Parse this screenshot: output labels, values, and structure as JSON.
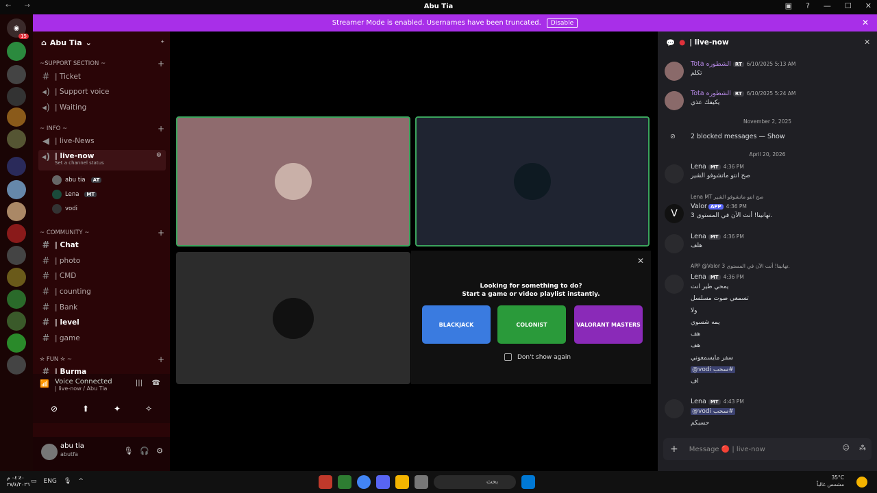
{
  "window": {
    "title": "Abu Tia",
    "nav": "← →"
  },
  "banner": {
    "text": "Streamer Mode is enabled. Usernames have been truncated.",
    "button": "Disable"
  },
  "guilds": {
    "badge": "15"
  },
  "server": {
    "name": "Abu Tia"
  },
  "categories": [
    {
      "label": "~SUPPORT SECTION ~"
    },
    {
      "label": "~ INFO ~"
    },
    {
      "label": "~ COMMUNITY ~"
    },
    {
      "label": "✮ FUN ✮ ~"
    }
  ],
  "channels": [
    {
      "name": "| Ticket"
    },
    {
      "name": "| Support voice"
    },
    {
      "name": "| Waiting"
    },
    {
      "name": "| live-News"
    },
    {
      "name": "| live-now",
      "sub": "Set a channel status"
    },
    {
      "name": "| Chat"
    },
    {
      "name": "| photo"
    },
    {
      "name": "| CMD"
    },
    {
      "name": "| counting"
    },
    {
      "name": "| Bank"
    },
    {
      "name": "| level"
    },
    {
      "name": "| game"
    },
    {
      "name": "| Burma"
    }
  ],
  "voice_users": [
    {
      "name": "abu tia",
      "tag": "AT"
    },
    {
      "name": "Lena",
      "tag": "MT"
    },
    {
      "name": "vodi",
      "tag": ""
    }
  ],
  "voice_panel": {
    "status": "Voice Connected",
    "location": "| live-now / Abu Tia"
  },
  "me": {
    "name": "abu tia",
    "status": "abutfa"
  },
  "activity": {
    "line1": "Looking for something to do?",
    "line2": "Start a game or video playlist instantly.",
    "cards": [
      "BLACKJACK",
      "COLONIST",
      "VALORANT MASTERS"
    ],
    "checkbox": "Don't show again"
  },
  "chat": {
    "channel": "| live-now",
    "messages": [
      {
        "author": "Tota",
        "author_suffix": "الشطوره",
        "tag": "RT",
        "time": "6/10/2025 5:13 AM",
        "body": "تكلم"
      },
      {
        "author": "Tota",
        "author_suffix": "الشطوره",
        "tag": "RT",
        "time": "6/10/2025 5:24 AM",
        "body": "يكيفك عذي"
      },
      {
        "sep": "November 2, 2025"
      },
      {
        "blocked": "2 blocked messages — Show"
      },
      {
        "sep": "April 20, 2026"
      },
      {
        "author": "Lena",
        "tag": "MT",
        "time": "4:36 PM",
        "body": "صح انتو ماتشوفو الشير"
      },
      {
        "reply": "Lena  MT  صح انتو ماتشوفو الشير",
        "author": "Valor",
        "tag": "APP",
        "time": "4:36 PM",
        "body": "تهانينا! أنت الآن في المستوى 3."
      },
      {
        "author": "Lena",
        "tag": "MT",
        "time": "4:36 PM",
        "body": "هلف"
      },
      {
        "reply": "APP @Valor تهانينا! أنت الآن في المستوى 3.",
        "author": "Lena",
        "tag": "MT",
        "time": "4:36 PM",
        "lines": [
          "يمحي طير انت",
          "تسمعي صوت مسلسل",
          "ولا",
          "يمه شسوي",
          "هف",
          "هف",
          "سفر مايسمعوني",
          "@vodi سحب#",
          "اف"
        ]
      },
      {
        "author": "Lena",
        "tag": "MT",
        "time": "4:43 PM",
        "lines": [
          "@vodi سحب#",
          "حسبكم"
        ]
      }
    ],
    "input_placeholder": "Message 🔴 | live-now"
  },
  "taskbar": {
    "time": "٠٤:٤٠ م",
    "date": "٢٧/٤/٢٠٢٦",
    "lang": "ENG",
    "search": "بحث",
    "temp": "35°C",
    "weather": "مشمس غالباً"
  }
}
